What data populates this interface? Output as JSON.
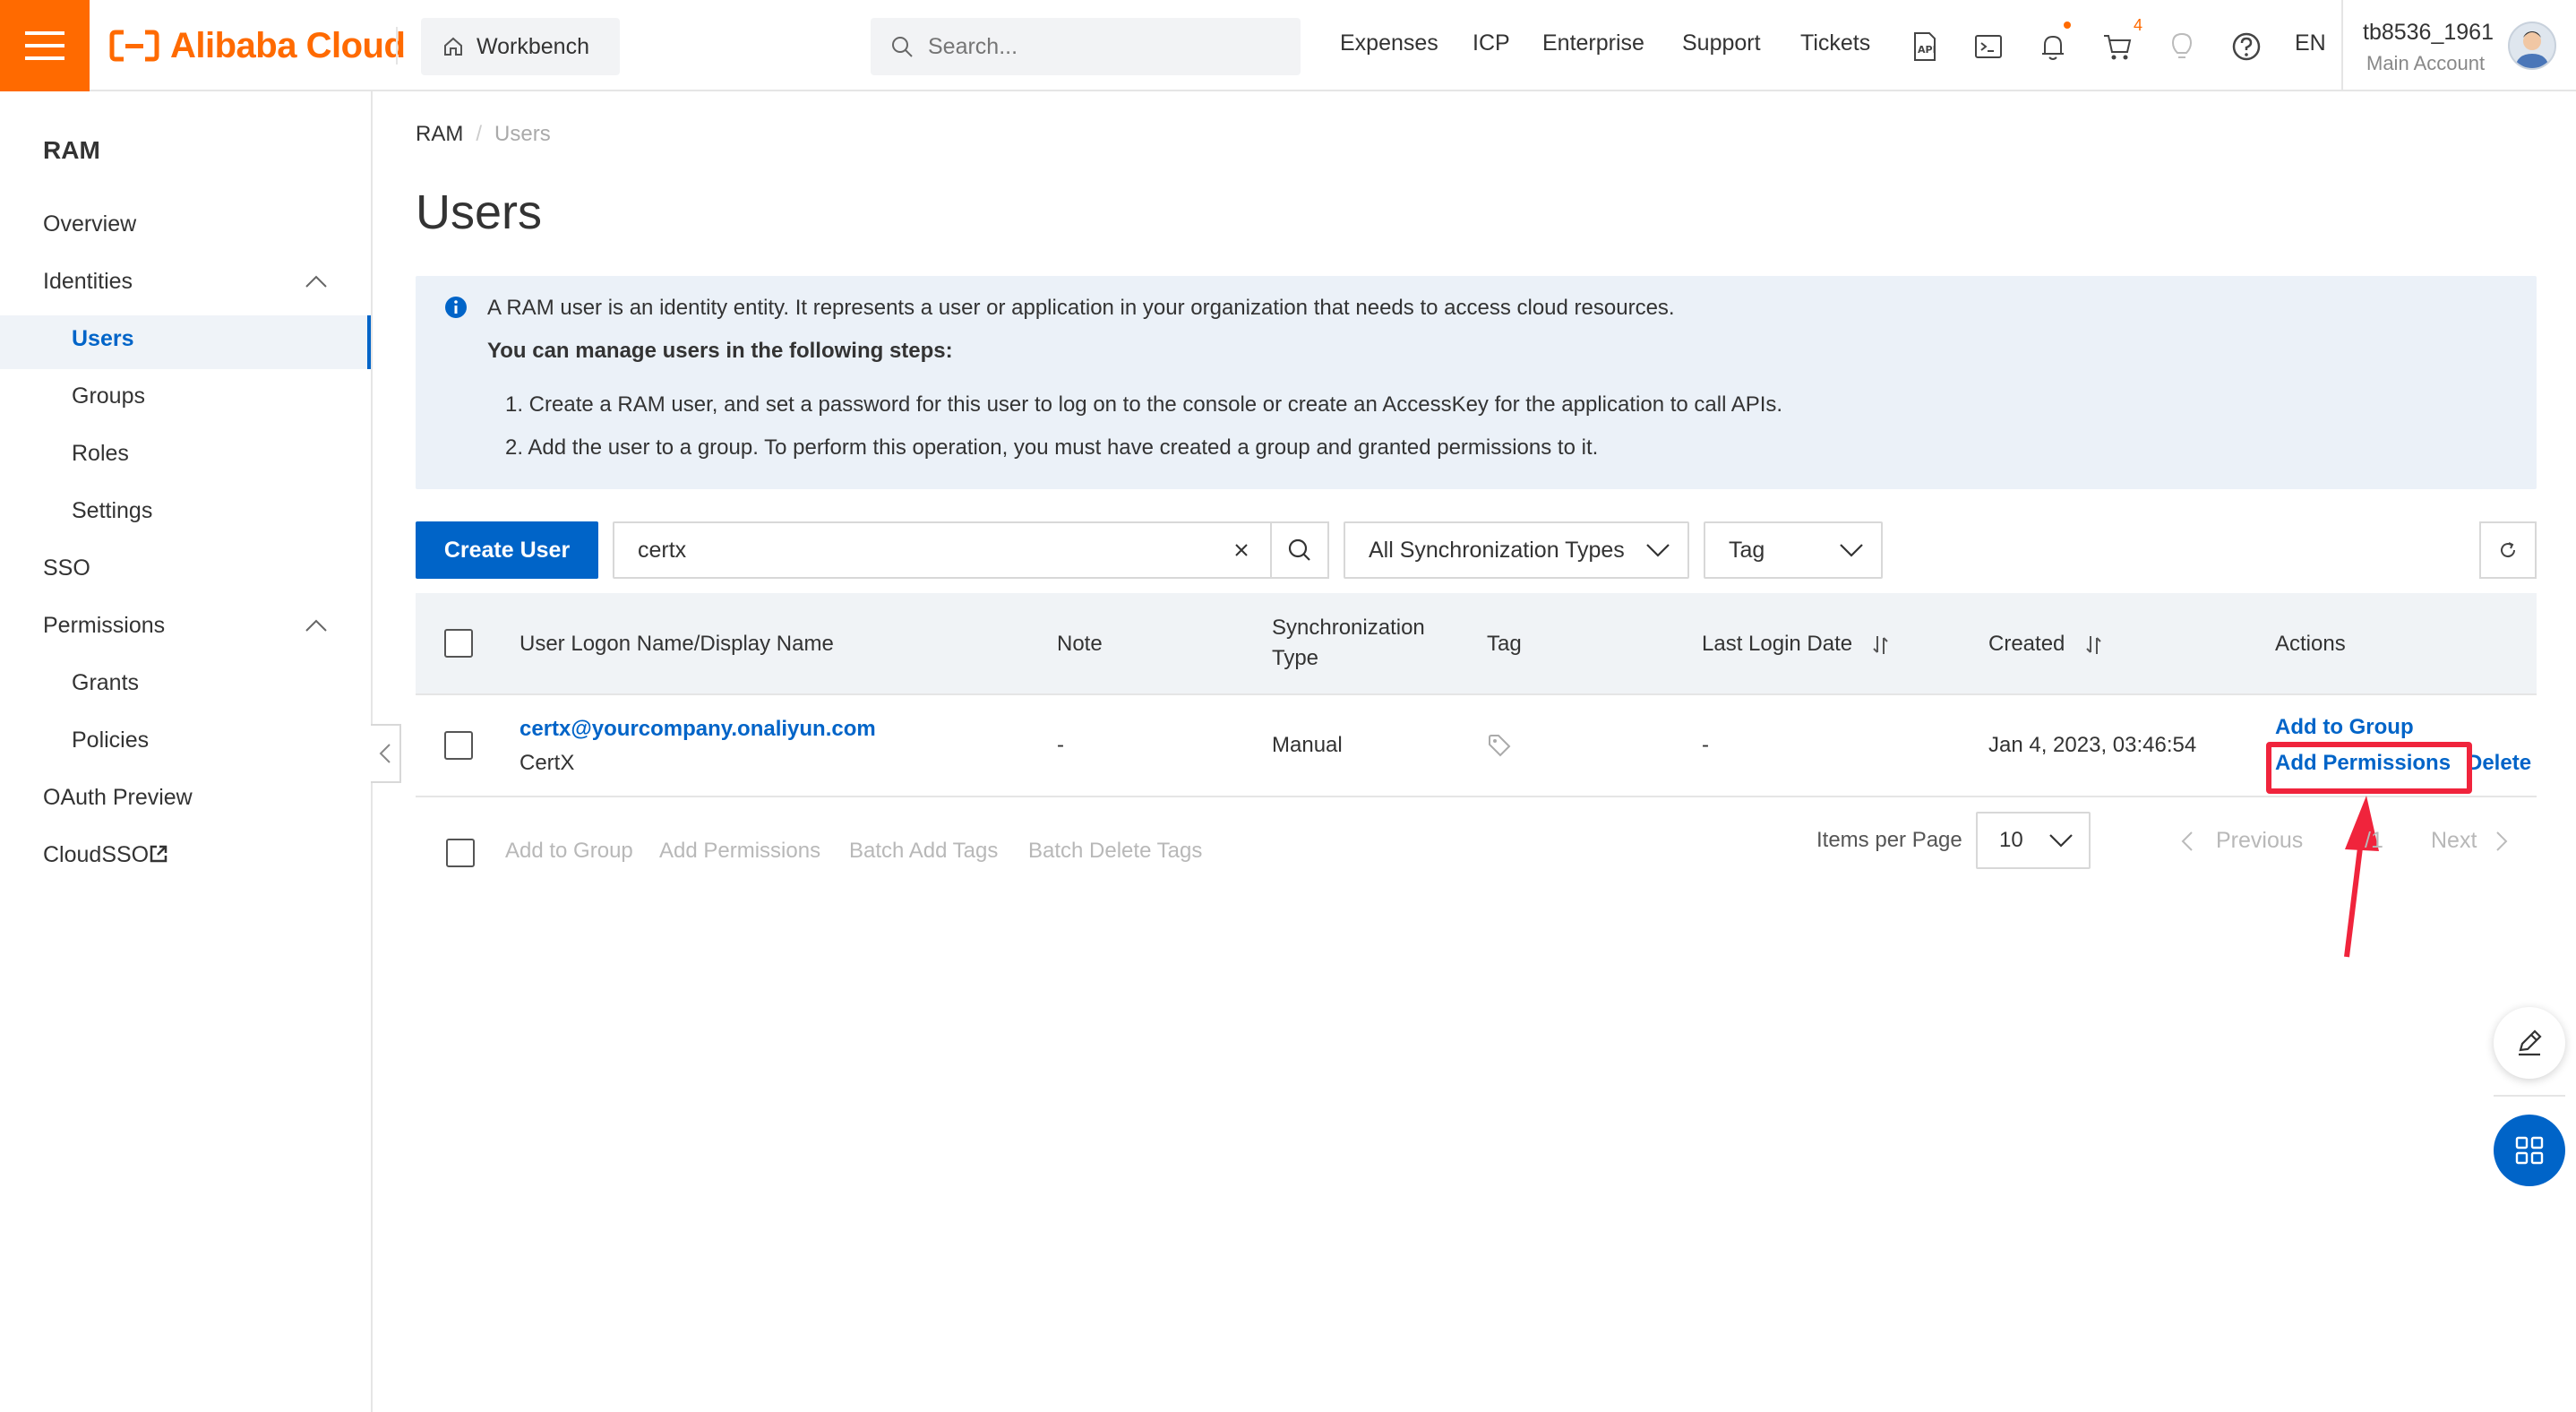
{
  "header": {
    "logo_text": "Alibaba Cloud",
    "workbench_label": "Workbench",
    "search_placeholder": "Search...",
    "nav": [
      "Expenses",
      "ICP",
      "Enterprise",
      "Support",
      "Tickets"
    ],
    "cart_count": "4",
    "language": "EN",
    "username": "tb8536_1961",
    "account_type": "Main Account"
  },
  "sidebar": {
    "title": "RAM",
    "items": {
      "overview": "Overview",
      "identities": "Identities",
      "users": "Users",
      "groups": "Groups",
      "roles": "Roles",
      "settings": "Settings",
      "sso": "SSO",
      "permissions": "Permissions",
      "grants": "Grants",
      "policies": "Policies",
      "oauth": "OAuth Preview",
      "cloudsso": "CloudSSO"
    }
  },
  "breadcrumb": {
    "root": "RAM",
    "current": "Users"
  },
  "page_title": "Users",
  "notice": {
    "line1": "A RAM user is an identity entity. It represents a user or application in your organization that needs to access cloud resources.",
    "line2": "You can manage users in the following steps:",
    "step1": "1. Create a RAM user, and set a password for this user to log on to the console or create an AccessKey for the application to call APIs.",
    "step2": "2. Add the user to a group. To perform this operation, you must have created a group and granted permissions to it."
  },
  "toolbar": {
    "create_user": "Create User",
    "search_value": "certx",
    "sync_type": "All Synchronization Types",
    "tag": "Tag"
  },
  "table": {
    "headers": {
      "name": "User Logon Name/Display Name",
      "note": "Note",
      "sync_line1": "Synchronization",
      "sync_line2": "Type",
      "tag": "Tag",
      "last_login": "Last Login Date",
      "created": "Created",
      "actions": "Actions"
    },
    "rows": [
      {
        "logon_name": "certx@yourcompany.onaliyun.com",
        "display_name": "CertX",
        "note": "-",
        "sync_type": "Manual",
        "last_login": "-",
        "created": "Jan 4, 2023, 03:46:54",
        "action_add_group": "Add to Group",
        "action_add_permissions": "Add Permissions",
        "action_delete": "Delete"
      }
    ]
  },
  "footer": {
    "add_to_group": "Add to Group",
    "add_permissions": "Add Permissions",
    "batch_add_tags": "Batch Add Tags",
    "batch_delete_tags": "Batch Delete Tags",
    "items_per_page": "Items per Page",
    "page_size": "10",
    "previous": "Previous",
    "page_indicator": "/1",
    "next": "Next"
  },
  "colors": {
    "brand_orange": "#ff6a00",
    "primary_blue": "#0064c8",
    "highlight_red": "#f0243c"
  }
}
